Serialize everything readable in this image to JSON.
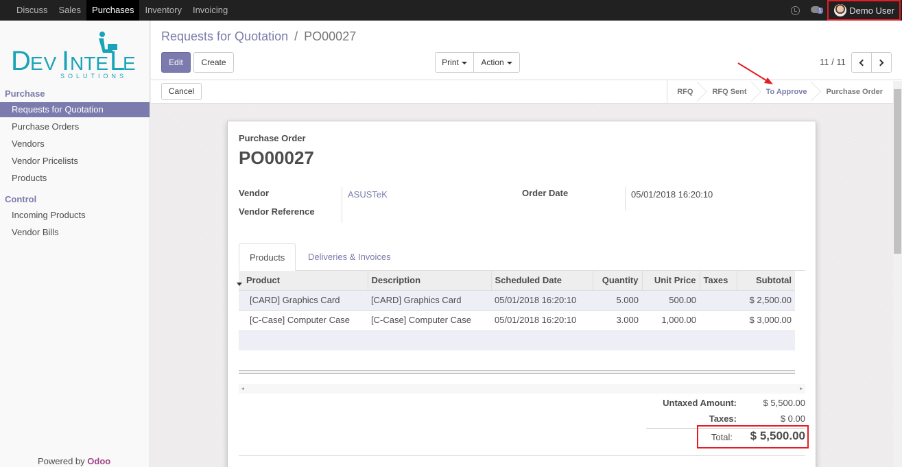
{
  "topbar": {
    "menu": [
      "Discuss",
      "Sales",
      "Purchases",
      "Inventory",
      "Invoicing"
    ],
    "active_menu": "Purchases",
    "chat_count": "1",
    "user_name": "Demo User"
  },
  "sidebar": {
    "logo_text": "DevIntelle",
    "logo_sub": "SOLUTIONS",
    "sections": [
      {
        "title": "Purchase",
        "items": [
          "Requests for Quotation",
          "Purchase Orders",
          "Vendors",
          "Vendor Pricelists",
          "Products"
        ]
      },
      {
        "title": "Control",
        "items": [
          "Incoming Products",
          "Vendor Bills"
        ]
      }
    ],
    "active_item": "Requests for Quotation",
    "powered_prefix": "Powered by",
    "powered_brand": "Odoo"
  },
  "control_panel": {
    "breadcrumb_parent": "Requests for Quotation",
    "breadcrumb_sep": "/",
    "breadcrumb_current": "PO00027",
    "edit_label": "Edit",
    "create_label": "Create",
    "print_label": "Print",
    "action_label": "Action",
    "pager": "11 / 11"
  },
  "statusbar": {
    "cancel_label": "Cancel",
    "stages": [
      "RFQ",
      "RFQ Sent",
      "To Approve",
      "Purchase Order"
    ],
    "current_stage": "To Approve"
  },
  "form": {
    "doc_type": "Purchase Order",
    "name": "PO00027",
    "vendor_label": "Vendor",
    "vendor_value": "ASUSTeK",
    "vendor_ref_label": "Vendor Reference",
    "order_date_label": "Order Date",
    "order_date_value": "05/01/2018 16:20:10",
    "tabs": [
      "Products",
      "Deliveries & Invoices"
    ],
    "columns": [
      "Product",
      "Description",
      "Scheduled Date",
      "Quantity",
      "Unit Price",
      "Taxes",
      "Subtotal"
    ],
    "lines": [
      {
        "product": "[CARD] Graphics Card",
        "description": "[CARD] Graphics Card",
        "date": "05/01/2018 16:20:10",
        "qty": "5.000",
        "price": "500.00",
        "taxes": "",
        "subtotal": "$ 2,500.00"
      },
      {
        "product": "[C-Case] Computer Case",
        "description": "[C-Case] Computer Case",
        "date": "05/01/2018 16:20:10",
        "qty": "3.000",
        "price": "1,000.00",
        "taxes": "",
        "subtotal": "$ 3,000.00"
      }
    ],
    "untaxed_label": "Untaxed Amount:",
    "untaxed_value": "$ 5,500.00",
    "taxes_label": "Taxes:",
    "taxes_value": "$ 0.00",
    "total_label": "Total:",
    "total_value": "$ 5,500.00"
  },
  "colors": {
    "accent": "#7c7bad",
    "highlight_red": "#e41c23",
    "topbar": "#212121"
  }
}
